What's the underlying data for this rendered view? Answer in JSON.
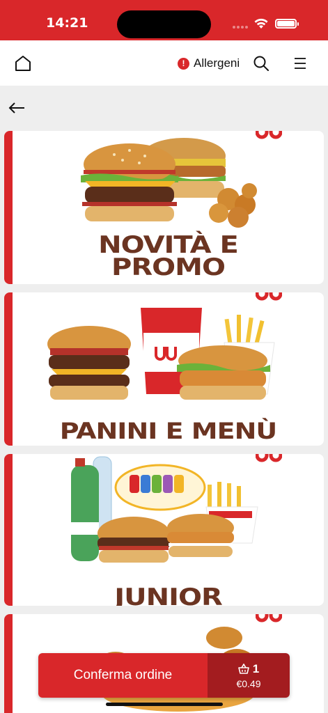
{
  "status_bar": {
    "time": "14:21"
  },
  "header": {
    "home_icon": "home-icon",
    "allergens_label": "Allergeni",
    "search_icon": "search-icon",
    "menu_icon": "hamburger-menu-icon"
  },
  "navigation": {
    "back_icon": "arrow-left-icon"
  },
  "categories": [
    {
      "title_line1": "NOVITÀ E",
      "title_line2": "PROMO"
    },
    {
      "title_line1": "PANINI E MENÙ"
    },
    {
      "title_line1": "JUNIOR"
    },
    {
      "title_line1": ""
    }
  ],
  "order_bar": {
    "confirm_label": "Conferma ordine",
    "cart_count": "1",
    "cart_total": "€0.49"
  },
  "colors": {
    "brand_red": "#d9272a",
    "dark_red": "#a31c1f",
    "title_brown": "#6b3421"
  }
}
